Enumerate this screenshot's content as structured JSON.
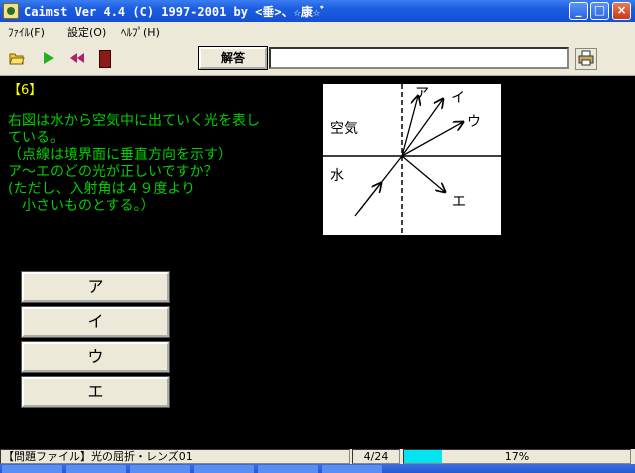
{
  "window": {
    "title": "Caimst Ver 4.4 (C) 1997-2001  by <垂>、☆康☆ﾞ"
  },
  "menu": {
    "file": "ﾌｧｲﾙ(F)",
    "settings": "設定(O)",
    "help": "ﾍﾙﾌﾟ(H)"
  },
  "toolbar": {
    "open_icon": "folder-open-icon",
    "play_icon": "play-icon",
    "rewind_icon": "rewind-icon",
    "exit_icon": "exit-door-icon",
    "answer_label": "解答",
    "answer_value": "",
    "print_icon": "printer-icon"
  },
  "question": {
    "number": "【6】",
    "lines": [
      "右図は水から空気中に出ていく光を表し",
      "ている。",
      "（点線は境界面に垂直方向を示す）",
      "ア〜エのどの光が正しいですか？",
      "(ただし、入射角は４９度より",
      "　小さいものとする。）"
    ]
  },
  "diagram": {
    "label_air": "空気",
    "label_water": "水",
    "ray_labels": [
      "ア",
      "イ",
      "ウ",
      "エ"
    ]
  },
  "choices": [
    "ア",
    "イ",
    "ウ",
    "エ"
  ],
  "status": {
    "file": "【問題ファイル】光の屈折・レンズ01",
    "count": "4/24",
    "progress_percent": 17,
    "progress_text": "17%"
  },
  "colors": {
    "question_text": "#00d000",
    "question_number": "#ffff00",
    "progress_fill": "#00e5f0"
  }
}
